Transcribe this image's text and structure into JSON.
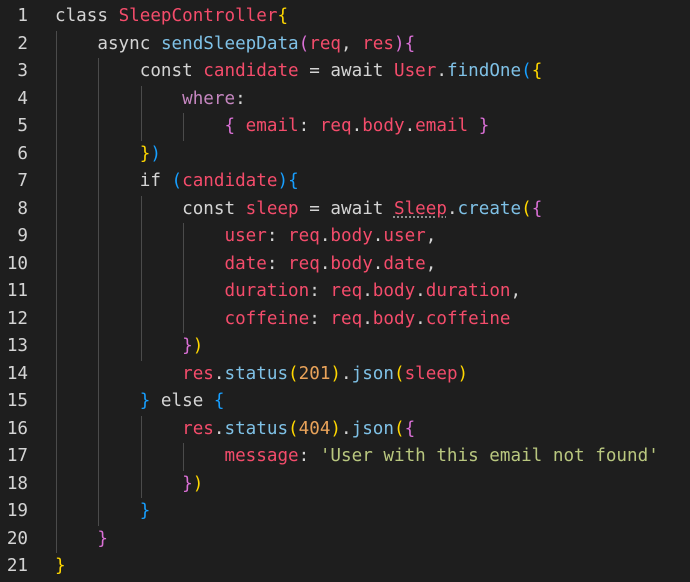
{
  "colors": {
    "background": "#1e1e1e",
    "line_number": "#d4d4d4",
    "keyword": "#c586c0",
    "identifier": "#f44c6b",
    "plain": "#d4d4d4",
    "function": "#7fc1e6",
    "number": "#e9a35a",
    "string": "#b9c77f",
    "bracket_gold": "#ffd700",
    "bracket_pink": "#da70d6",
    "bracket_blue": "#179fff"
  },
  "lines": [
    {
      "n": "1",
      "tokens": [
        {
          "t": "class ",
          "c": "plain"
        },
        {
          "t": "SleepController",
          "c": "identifier"
        },
        {
          "t": "{",
          "c": "bracket_gold"
        }
      ]
    },
    {
      "n": "2",
      "tokens": [
        {
          "t": "    async ",
          "c": "plain"
        },
        {
          "t": "sendSleepData",
          "c": "function"
        },
        {
          "t": "(",
          "c": "bracket_pink"
        },
        {
          "t": "req",
          "c": "identifier"
        },
        {
          "t": ", ",
          "c": "plain"
        },
        {
          "t": "res",
          "c": "identifier"
        },
        {
          "t": ")",
          "c": "bracket_pink"
        },
        {
          "t": "{",
          "c": "bracket_pink"
        }
      ]
    },
    {
      "n": "3",
      "tokens": [
        {
          "t": "        const ",
          "c": "plain"
        },
        {
          "t": "candidate",
          "c": "identifier"
        },
        {
          "t": " = ",
          "c": "plain"
        },
        {
          "t": "await ",
          "c": "plain"
        },
        {
          "t": "User",
          "c": "identifier"
        },
        {
          "t": ".",
          "c": "plain"
        },
        {
          "t": "findOne",
          "c": "function"
        },
        {
          "t": "(",
          "c": "bracket_blue"
        },
        {
          "t": "{",
          "c": "bracket_gold"
        }
      ]
    },
    {
      "n": "4",
      "tokens": [
        {
          "t": "            ",
          "c": "plain"
        },
        {
          "t": "where",
          "c": "keyword"
        },
        {
          "t": ":",
          "c": "plain"
        }
      ]
    },
    {
      "n": "5",
      "tokens": [
        {
          "t": "                ",
          "c": "plain"
        },
        {
          "t": "{",
          "c": "bracket_pink"
        },
        {
          "t": " ",
          "c": "plain"
        },
        {
          "t": "email",
          "c": "identifier"
        },
        {
          "t": ": ",
          "c": "plain"
        },
        {
          "t": "req",
          "c": "identifier"
        },
        {
          "t": ".",
          "c": "plain"
        },
        {
          "t": "body",
          "c": "identifier"
        },
        {
          "t": ".",
          "c": "plain"
        },
        {
          "t": "email",
          "c": "identifier"
        },
        {
          "t": " ",
          "c": "plain"
        },
        {
          "t": "}",
          "c": "bracket_pink"
        }
      ]
    },
    {
      "n": "6",
      "tokens": [
        {
          "t": "        ",
          "c": "plain"
        },
        {
          "t": "}",
          "c": "bracket_gold"
        },
        {
          "t": ")",
          "c": "bracket_blue"
        }
      ]
    },
    {
      "n": "7",
      "tokens": [
        {
          "t": "        if ",
          "c": "plain"
        },
        {
          "t": "(",
          "c": "bracket_blue"
        },
        {
          "t": "candidate",
          "c": "identifier"
        },
        {
          "t": ")",
          "c": "bracket_blue"
        },
        {
          "t": "{",
          "c": "bracket_blue"
        }
      ]
    },
    {
      "n": "8",
      "tokens": [
        {
          "t": "            const ",
          "c": "plain"
        },
        {
          "t": "sleep",
          "c": "identifier"
        },
        {
          "t": " = ",
          "c": "plain"
        },
        {
          "t": "await ",
          "c": "plain"
        },
        {
          "t": "Sleep",
          "c": "identifier",
          "squiggle": true
        },
        {
          "t": ".",
          "c": "plain"
        },
        {
          "t": "create",
          "c": "function"
        },
        {
          "t": "(",
          "c": "bracket_gold"
        },
        {
          "t": "{",
          "c": "bracket_pink"
        }
      ]
    },
    {
      "n": "9",
      "tokens": [
        {
          "t": "                ",
          "c": "plain"
        },
        {
          "t": "user",
          "c": "identifier"
        },
        {
          "t": ": ",
          "c": "plain"
        },
        {
          "t": "req",
          "c": "identifier"
        },
        {
          "t": ".",
          "c": "plain"
        },
        {
          "t": "body",
          "c": "identifier"
        },
        {
          "t": ".",
          "c": "plain"
        },
        {
          "t": "user",
          "c": "identifier"
        },
        {
          "t": ",",
          "c": "plain"
        }
      ]
    },
    {
      "n": "10",
      "tokens": [
        {
          "t": "                ",
          "c": "plain"
        },
        {
          "t": "date",
          "c": "identifier"
        },
        {
          "t": ": ",
          "c": "plain"
        },
        {
          "t": "req",
          "c": "identifier"
        },
        {
          "t": ".",
          "c": "plain"
        },
        {
          "t": "body",
          "c": "identifier"
        },
        {
          "t": ".",
          "c": "plain"
        },
        {
          "t": "date",
          "c": "identifier"
        },
        {
          "t": ",",
          "c": "plain"
        }
      ]
    },
    {
      "n": "11",
      "tokens": [
        {
          "t": "                ",
          "c": "plain"
        },
        {
          "t": "duration",
          "c": "identifier"
        },
        {
          "t": ": ",
          "c": "plain"
        },
        {
          "t": "req",
          "c": "identifier"
        },
        {
          "t": ".",
          "c": "plain"
        },
        {
          "t": "body",
          "c": "identifier"
        },
        {
          "t": ".",
          "c": "plain"
        },
        {
          "t": "duration",
          "c": "identifier"
        },
        {
          "t": ",",
          "c": "plain"
        }
      ]
    },
    {
      "n": "12",
      "tokens": [
        {
          "t": "                ",
          "c": "plain"
        },
        {
          "t": "coffeine",
          "c": "identifier"
        },
        {
          "t": ": ",
          "c": "plain"
        },
        {
          "t": "req",
          "c": "identifier"
        },
        {
          "t": ".",
          "c": "plain"
        },
        {
          "t": "body",
          "c": "identifier"
        },
        {
          "t": ".",
          "c": "plain"
        },
        {
          "t": "coffeine",
          "c": "identifier"
        }
      ]
    },
    {
      "n": "13",
      "tokens": [
        {
          "t": "            ",
          "c": "plain"
        },
        {
          "t": "}",
          "c": "bracket_pink"
        },
        {
          "t": ")",
          "c": "bracket_gold"
        }
      ]
    },
    {
      "n": "14",
      "tokens": [
        {
          "t": "            ",
          "c": "plain"
        },
        {
          "t": "res",
          "c": "identifier"
        },
        {
          "t": ".",
          "c": "plain"
        },
        {
          "t": "status",
          "c": "function"
        },
        {
          "t": "(",
          "c": "bracket_gold"
        },
        {
          "t": "201",
          "c": "number"
        },
        {
          "t": ")",
          "c": "bracket_gold"
        },
        {
          "t": ".",
          "c": "plain"
        },
        {
          "t": "json",
          "c": "function"
        },
        {
          "t": "(",
          "c": "bracket_gold"
        },
        {
          "t": "sleep",
          "c": "identifier"
        },
        {
          "t": ")",
          "c": "bracket_gold"
        }
      ]
    },
    {
      "n": "15",
      "tokens": [
        {
          "t": "        ",
          "c": "plain"
        },
        {
          "t": "}",
          "c": "bracket_blue"
        },
        {
          "t": " else ",
          "c": "plain"
        },
        {
          "t": "{",
          "c": "bracket_blue"
        }
      ]
    },
    {
      "n": "16",
      "tokens": [
        {
          "t": "            ",
          "c": "plain"
        },
        {
          "t": "res",
          "c": "identifier"
        },
        {
          "t": ".",
          "c": "plain"
        },
        {
          "t": "status",
          "c": "function"
        },
        {
          "t": "(",
          "c": "bracket_gold"
        },
        {
          "t": "404",
          "c": "number"
        },
        {
          "t": ")",
          "c": "bracket_gold"
        },
        {
          "t": ".",
          "c": "plain"
        },
        {
          "t": "json",
          "c": "function"
        },
        {
          "t": "(",
          "c": "bracket_gold"
        },
        {
          "t": "{",
          "c": "bracket_pink"
        }
      ]
    },
    {
      "n": "17",
      "tokens": [
        {
          "t": "                ",
          "c": "plain"
        },
        {
          "t": "message",
          "c": "identifier"
        },
        {
          "t": ": ",
          "c": "plain"
        },
        {
          "t": "'User with this email not found'",
          "c": "string"
        }
      ]
    },
    {
      "n": "18",
      "tokens": [
        {
          "t": "            ",
          "c": "plain"
        },
        {
          "t": "}",
          "c": "bracket_pink"
        },
        {
          "t": ")",
          "c": "bracket_gold"
        }
      ]
    },
    {
      "n": "19",
      "tokens": [
        {
          "t": "        ",
          "c": "plain"
        },
        {
          "t": "}",
          "c": "bracket_blue"
        }
      ]
    },
    {
      "n": "20",
      "tokens": [
        {
          "t": "    ",
          "c": "plain"
        },
        {
          "t": "}",
          "c": "bracket_pink"
        }
      ]
    },
    {
      "n": "21",
      "tokens": [
        {
          "t": "}",
          "c": "bracket_gold"
        }
      ]
    }
  ]
}
